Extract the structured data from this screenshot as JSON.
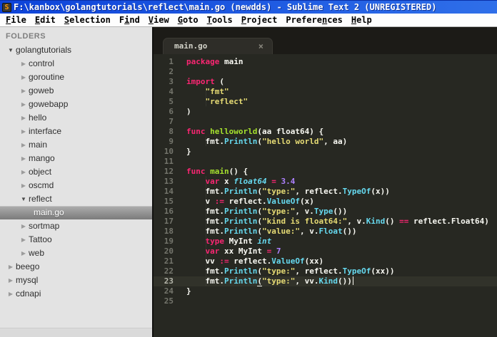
{
  "window": {
    "title": "F:\\kanbox\\golangtutorials\\reflect\\main.go (newdds) - Sublime Text 2 (UNREGISTERED)",
    "icon_glyph": "S"
  },
  "menu": {
    "items": [
      {
        "name": "file",
        "pre": "",
        "key": "F",
        "post": "ile"
      },
      {
        "name": "edit",
        "pre": "",
        "key": "E",
        "post": "dit"
      },
      {
        "name": "selection",
        "pre": "",
        "key": "S",
        "post": "election"
      },
      {
        "name": "find",
        "pre": "F",
        "key": "i",
        "post": "nd"
      },
      {
        "name": "view",
        "pre": "",
        "key": "V",
        "post": "iew"
      },
      {
        "name": "goto",
        "pre": "",
        "key": "G",
        "post": "oto"
      },
      {
        "name": "tools",
        "pre": "",
        "key": "T",
        "post": "ools"
      },
      {
        "name": "project",
        "pre": "",
        "key": "P",
        "post": "roject"
      },
      {
        "name": "preferences",
        "pre": "Prefere",
        "key": "n",
        "post": "ces"
      },
      {
        "name": "help",
        "pre": "",
        "key": "H",
        "post": "elp"
      }
    ]
  },
  "sidebar": {
    "header": "FOLDERS",
    "items": [
      {
        "label": "golangtutorials",
        "level": 0,
        "state": "expanded",
        "selected": false
      },
      {
        "label": "control",
        "level": 1,
        "state": "collapsed",
        "selected": false
      },
      {
        "label": "goroutine",
        "level": 1,
        "state": "collapsed",
        "selected": false
      },
      {
        "label": "goweb",
        "level": 1,
        "state": "collapsed",
        "selected": false
      },
      {
        "label": "gowebapp",
        "level": 1,
        "state": "collapsed",
        "selected": false
      },
      {
        "label": "hello",
        "level": 1,
        "state": "collapsed",
        "selected": false
      },
      {
        "label": "interface",
        "level": 1,
        "state": "collapsed",
        "selected": false
      },
      {
        "label": "main",
        "level": 1,
        "state": "collapsed",
        "selected": false
      },
      {
        "label": "mango",
        "level": 1,
        "state": "collapsed",
        "selected": false
      },
      {
        "label": "object",
        "level": 1,
        "state": "collapsed",
        "selected": false
      },
      {
        "label": "oscmd",
        "level": 1,
        "state": "collapsed",
        "selected": false
      },
      {
        "label": "reflect",
        "level": 1,
        "state": "expanded",
        "selected": false
      },
      {
        "label": "main.go",
        "level": 2,
        "state": "file",
        "selected": true
      },
      {
        "label": "sortmap",
        "level": 1,
        "state": "collapsed",
        "selected": false
      },
      {
        "label": "Tattoo",
        "level": 1,
        "state": "collapsed",
        "selected": false
      },
      {
        "label": "web",
        "level": 1,
        "state": "collapsed",
        "selected": false
      },
      {
        "label": "beego",
        "level": 0,
        "state": "collapsed",
        "selected": false
      },
      {
        "label": "mysql",
        "level": 0,
        "state": "collapsed",
        "selected": false
      },
      {
        "label": "cdnapi",
        "level": 0,
        "state": "collapsed",
        "selected": false
      }
    ]
  },
  "tabbar": {
    "tabs": [
      {
        "label": "main.go",
        "close_glyph": "×",
        "active": true
      }
    ]
  },
  "editor": {
    "language": "go",
    "lines": [
      {
        "no": 1,
        "active": false,
        "tokens": [
          [
            "k",
            "package"
          ],
          [
            "p",
            " main"
          ]
        ]
      },
      {
        "no": 2,
        "active": false,
        "tokens": []
      },
      {
        "no": 3,
        "active": false,
        "tokens": [
          [
            "k",
            "import"
          ],
          [
            "p",
            " ("
          ]
        ]
      },
      {
        "no": 4,
        "active": false,
        "tokens": [
          [
            "ind",
            "    "
          ],
          [
            "s",
            "\"fmt\""
          ]
        ]
      },
      {
        "no": 5,
        "active": false,
        "tokens": [
          [
            "ind",
            "    "
          ],
          [
            "s",
            "\"reflect\""
          ]
        ]
      },
      {
        "no": 6,
        "active": false,
        "tokens": [
          [
            "p",
            ")"
          ]
        ]
      },
      {
        "no": 7,
        "active": false,
        "tokens": []
      },
      {
        "no": 8,
        "active": false,
        "tokens": [
          [
            "k",
            "func"
          ],
          [
            "p",
            " "
          ],
          [
            "fn",
            "helloworld"
          ],
          [
            "p",
            "(aa float64) {"
          ]
        ]
      },
      {
        "no": 9,
        "active": false,
        "tokens": [
          [
            "ind",
            "    "
          ],
          [
            "p",
            "fmt."
          ],
          [
            "c",
            "Println"
          ],
          [
            "p",
            "("
          ],
          [
            "s",
            "\"hello world\""
          ],
          [
            "p",
            ", aa)"
          ]
        ]
      },
      {
        "no": 10,
        "active": false,
        "tokens": [
          [
            "p",
            "}"
          ]
        ]
      },
      {
        "no": 11,
        "active": false,
        "tokens": []
      },
      {
        "no": 12,
        "active": false,
        "tokens": [
          [
            "k",
            "func"
          ],
          [
            "p",
            " "
          ],
          [
            "fn",
            "main"
          ],
          [
            "p",
            "() {"
          ]
        ]
      },
      {
        "no": 13,
        "active": false,
        "tokens": [
          [
            "ind",
            "    "
          ],
          [
            "k",
            "var"
          ],
          [
            "p",
            " x "
          ],
          [
            "t",
            "float64"
          ],
          [
            "p",
            " "
          ],
          [
            "k",
            "="
          ],
          [
            "p",
            " "
          ],
          [
            "n",
            "3.4"
          ]
        ]
      },
      {
        "no": 14,
        "active": false,
        "tokens": [
          [
            "ind",
            "    "
          ],
          [
            "p",
            "fmt."
          ],
          [
            "c",
            "Println"
          ],
          [
            "p",
            "("
          ],
          [
            "s",
            "\"type:\""
          ],
          [
            "p",
            ", reflect."
          ],
          [
            "c",
            "TypeOf"
          ],
          [
            "p",
            "(x))"
          ]
        ]
      },
      {
        "no": 15,
        "active": false,
        "tokens": [
          [
            "ind",
            "    "
          ],
          [
            "p",
            "v "
          ],
          [
            "k",
            ":="
          ],
          [
            "p",
            " reflect."
          ],
          [
            "c",
            "ValueOf"
          ],
          [
            "p",
            "(x)"
          ]
        ]
      },
      {
        "no": 16,
        "active": false,
        "tokens": [
          [
            "ind",
            "    "
          ],
          [
            "p",
            "fmt."
          ],
          [
            "c",
            "Println"
          ],
          [
            "p",
            "("
          ],
          [
            "s",
            "\"type:\""
          ],
          [
            "p",
            ", v."
          ],
          [
            "c",
            "Type"
          ],
          [
            "p",
            "())"
          ]
        ]
      },
      {
        "no": 17,
        "active": false,
        "tokens": [
          [
            "ind",
            "    "
          ],
          [
            "p",
            "fmt."
          ],
          [
            "c",
            "Println"
          ],
          [
            "p",
            "("
          ],
          [
            "s",
            "\"kind is float64:\""
          ],
          [
            "p",
            ", v."
          ],
          [
            "c",
            "Kind"
          ],
          [
            "p",
            "() "
          ],
          [
            "k",
            "=="
          ],
          [
            "p",
            " reflect.Float64)"
          ]
        ]
      },
      {
        "no": 18,
        "active": false,
        "tokens": [
          [
            "ind",
            "    "
          ],
          [
            "p",
            "fmt."
          ],
          [
            "c",
            "Println"
          ],
          [
            "p",
            "("
          ],
          [
            "s",
            "\"value:\""
          ],
          [
            "p",
            ", v."
          ],
          [
            "c",
            "Float"
          ],
          [
            "p",
            "())"
          ]
        ]
      },
      {
        "no": 19,
        "active": false,
        "tokens": [
          [
            "ind",
            "    "
          ],
          [
            "k",
            "type"
          ],
          [
            "p",
            " MyInt "
          ],
          [
            "t",
            "int"
          ]
        ]
      },
      {
        "no": 20,
        "active": false,
        "tokens": [
          [
            "ind",
            "    "
          ],
          [
            "k",
            "var"
          ],
          [
            "p",
            " xx MyInt "
          ],
          [
            "k",
            "="
          ],
          [
            "p",
            " "
          ],
          [
            "n",
            "7"
          ]
        ]
      },
      {
        "no": 21,
        "active": false,
        "tokens": [
          [
            "ind",
            "    "
          ],
          [
            "p",
            "vv "
          ],
          [
            "k",
            ":="
          ],
          [
            "p",
            " reflect."
          ],
          [
            "c",
            "ValueOf"
          ],
          [
            "p",
            "(xx)"
          ]
        ]
      },
      {
        "no": 22,
        "active": false,
        "tokens": [
          [
            "ind",
            "    "
          ],
          [
            "p",
            "fmt."
          ],
          [
            "c",
            "Println"
          ],
          [
            "p",
            "("
          ],
          [
            "s",
            "\"type:\""
          ],
          [
            "p",
            ", reflect."
          ],
          [
            "c",
            "TypeOf"
          ],
          [
            "p",
            "(xx))"
          ]
        ]
      },
      {
        "no": 23,
        "active": true,
        "tokens": [
          [
            "ind",
            "    "
          ],
          [
            "p",
            "fmt."
          ],
          [
            "c",
            "Println"
          ],
          [
            "pu",
            "("
          ],
          [
            "s",
            "\"type:\""
          ],
          [
            "p",
            ", vv."
          ],
          [
            "c",
            "Kind"
          ],
          [
            "p",
            "())"
          ],
          [
            "cursor",
            ""
          ]
        ]
      },
      {
        "no": 24,
        "active": false,
        "tokens": [
          [
            "p",
            "}"
          ]
        ]
      },
      {
        "no": 25,
        "active": false,
        "tokens": []
      }
    ]
  },
  "colors": {
    "titlebar_blue_left": "#0d43d9",
    "titlebar_blue_right": "#2f6fe9",
    "menubar_bg": "#fdfdfd",
    "sidebar_bg": "#e3e3e3",
    "sidebar_selected_top": "#aeaeae",
    "sidebar_selected_bottom": "#7b7b7b",
    "editor_bg": "#272822",
    "tabbar_bg": "#1c1b17",
    "tab_bg": "#2e2d28",
    "keyword": "#f92672",
    "string": "#e6db74",
    "func_def": "#a6e22e",
    "func_call": "#66d9ef",
    "type_italic": "#66d9ef",
    "number": "#ae81ff",
    "plain": "#f8f8f2",
    "gutter": "#74756c",
    "logo_orange": "#ff9800"
  }
}
